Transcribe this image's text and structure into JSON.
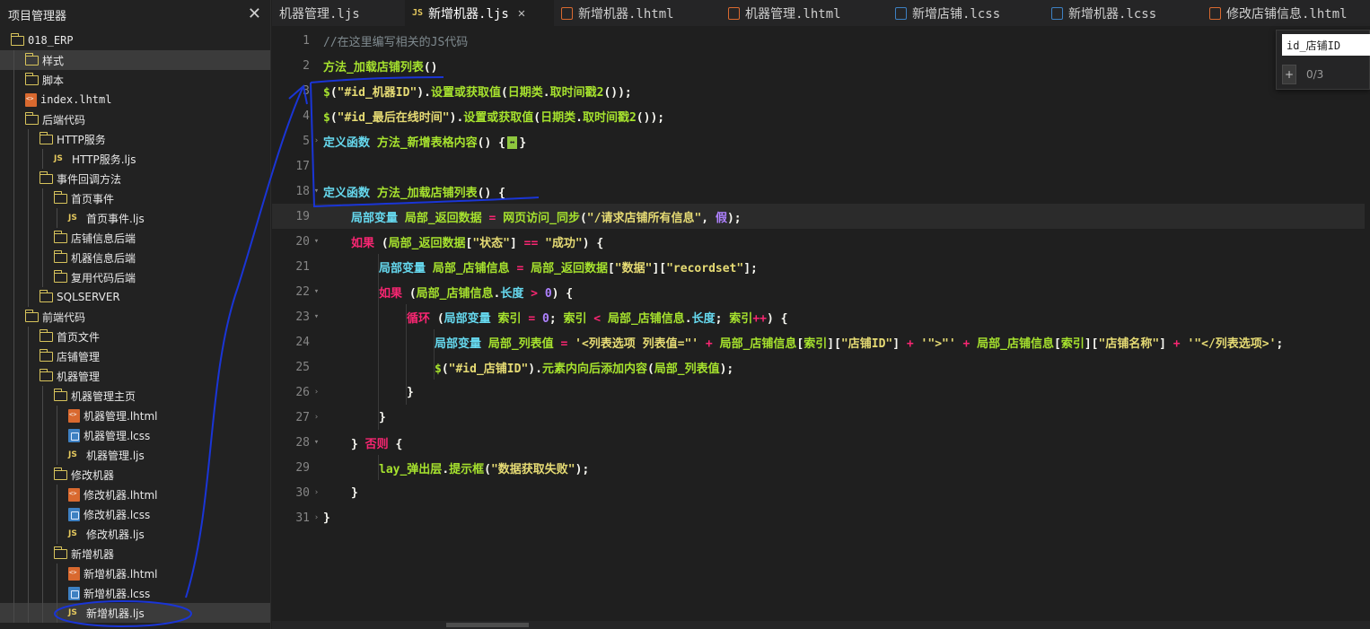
{
  "sidebar": {
    "title": "项目管理器",
    "close": "✕",
    "tree": [
      {
        "label": "018_ERP",
        "kind": "folder",
        "depth": 0,
        "mono": true
      },
      {
        "label": "样式",
        "kind": "folder",
        "depth": 1,
        "selected": true
      },
      {
        "label": "脚本",
        "kind": "folder",
        "depth": 1
      },
      {
        "label": "index.lhtml",
        "kind": "html",
        "depth": 1,
        "mono": true
      },
      {
        "label": "后端代码",
        "kind": "folder",
        "depth": 1
      },
      {
        "label": "HTTP服务",
        "kind": "folder",
        "depth": 2
      },
      {
        "label": "HTTP服务.ljs",
        "kind": "js",
        "depth": 3
      },
      {
        "label": "事件回调方法",
        "kind": "folder",
        "depth": 2
      },
      {
        "label": "首页事件",
        "kind": "folder",
        "depth": 3
      },
      {
        "label": "首页事件.ljs",
        "kind": "js",
        "depth": 4
      },
      {
        "label": "店铺信息后端",
        "kind": "folder",
        "depth": 3
      },
      {
        "label": "机器信息后端",
        "kind": "folder",
        "depth": 3
      },
      {
        "label": "复用代码后端",
        "kind": "folder",
        "depth": 3
      },
      {
        "label": "SQLSERVER",
        "kind": "folder",
        "depth": 2
      },
      {
        "label": "前端代码",
        "kind": "folder",
        "depth": 1
      },
      {
        "label": "首页文件",
        "kind": "folder",
        "depth": 2
      },
      {
        "label": "店铺管理",
        "kind": "folder",
        "depth": 2
      },
      {
        "label": "机器管理",
        "kind": "folder",
        "depth": 2
      },
      {
        "label": "机器管理主页",
        "kind": "folder",
        "depth": 3
      },
      {
        "label": "机器管理.lhtml",
        "kind": "html",
        "depth": 4
      },
      {
        "label": "机器管理.lcss",
        "kind": "css",
        "depth": 4
      },
      {
        "label": "机器管理.ljs",
        "kind": "js",
        "depth": 4
      },
      {
        "label": "修改机器",
        "kind": "folder",
        "depth": 3
      },
      {
        "label": "修改机器.lhtml",
        "kind": "html",
        "depth": 4
      },
      {
        "label": "修改机器.lcss",
        "kind": "css",
        "depth": 4
      },
      {
        "label": "修改机器.ljs",
        "kind": "js",
        "depth": 4
      },
      {
        "label": "新增机器",
        "kind": "folder",
        "depth": 3
      },
      {
        "label": "新增机器.lhtml",
        "kind": "html",
        "depth": 4
      },
      {
        "label": "新增机器.lcss",
        "kind": "css",
        "depth": 4
      },
      {
        "label": "新增机器.ljs",
        "kind": "js",
        "depth": 4,
        "selected": true
      }
    ]
  },
  "tabs": [
    {
      "label": "机器管理.ljs",
      "icon": "none",
      "active": false
    },
    {
      "label": "新增机器.ljs",
      "icon": "js",
      "active": true,
      "close": "✕"
    },
    {
      "label": "新增机器.lhtml",
      "icon": "html",
      "active": false
    },
    {
      "label": "机器管理.lhtml",
      "icon": "html",
      "active": false
    },
    {
      "label": "新增店铺.lcss",
      "icon": "css",
      "active": false
    },
    {
      "label": "新增机器.lcss",
      "icon": "css",
      "active": false
    },
    {
      "label": "修改店铺信息.lhtml",
      "icon": "html",
      "active": false
    }
  ],
  "find": {
    "value": "id_店铺ID",
    "toggle": "+",
    "count": "0/3"
  },
  "editor": {
    "lines": [
      {
        "n": "1",
        "indent": 0,
        "tokens": [
          [
            "cmt",
            "//在这里编写相关的JS代码"
          ]
        ]
      },
      {
        "n": "2",
        "indent": 0,
        "tokens": [
          [
            "fn",
            "方法_加载店铺列表"
          ],
          [
            "pl",
            "()"
          ]
        ]
      },
      {
        "n": "3",
        "indent": 0,
        "tokens": [
          [
            "fn",
            "$"
          ],
          [
            "pl",
            "("
          ],
          [
            "str",
            "\"#id_机器ID\""
          ],
          [
            "pl",
            ")."
          ],
          [
            "fn",
            "设置或获取值"
          ],
          [
            "pl",
            "("
          ],
          [
            "fn",
            "日期类"
          ],
          [
            "pl",
            "."
          ],
          [
            "fn",
            "取时间戳2"
          ],
          [
            "pl",
            "());"
          ]
        ]
      },
      {
        "n": "4",
        "indent": 0,
        "tokens": [
          [
            "fn",
            "$"
          ],
          [
            "pl",
            "("
          ],
          [
            "str",
            "\"#id_最后在线时间\""
          ],
          [
            "pl",
            ")."
          ],
          [
            "fn",
            "设置或获取值"
          ],
          [
            "pl",
            "("
          ],
          [
            "fn",
            "日期类"
          ],
          [
            "pl",
            "."
          ],
          [
            "fn",
            "取时间戳2"
          ],
          [
            "pl",
            "());"
          ]
        ]
      },
      {
        "n": "5",
        "indent": 0,
        "fold": "›",
        "tokens": [
          [
            "kw",
            "定义函数 "
          ],
          [
            "fn",
            "方法_新增表格内容"
          ],
          [
            "pl",
            "() {"
          ],
          [
            "box",
            "↔"
          ],
          [
            "pl",
            "}"
          ]
        ]
      },
      {
        "n": "17",
        "indent": 0,
        "tokens": []
      },
      {
        "n": "18",
        "indent": 0,
        "fold": "▾",
        "tokens": [
          [
            "kw",
            "定义函数 "
          ],
          [
            "fn",
            "方法_加载店铺列表"
          ],
          [
            "pl",
            "() {"
          ]
        ]
      },
      {
        "n": "19",
        "indent": 1,
        "current": true,
        "tokens": [
          [
            "kw",
            "局部变量 "
          ],
          [
            "fn",
            "局部_返回数据"
          ],
          [
            "op",
            " = "
          ],
          [
            "fn",
            "网页访问_同步"
          ],
          [
            "pl",
            "("
          ],
          [
            "str",
            "\"/请求店铺所有信息\""
          ],
          [
            "pl",
            ", "
          ],
          [
            "num",
            "假"
          ],
          [
            "pl",
            ");"
          ]
        ]
      },
      {
        "n": "20",
        "indent": 1,
        "fold": "▾",
        "tokens": [
          [
            "op",
            "如果 "
          ],
          [
            "pl",
            "("
          ],
          [
            "fn",
            "局部_返回数据"
          ],
          [
            "pl",
            "["
          ],
          [
            "str",
            "\"状态\""
          ],
          [
            "pl",
            "] "
          ],
          [
            "op",
            "=="
          ],
          [
            "pl",
            " "
          ],
          [
            "str",
            "\"成功\""
          ],
          [
            "pl",
            ") {"
          ]
        ]
      },
      {
        "n": "21",
        "indent": 2,
        "tokens": [
          [
            "kw",
            "局部变量 "
          ],
          [
            "fn",
            "局部_店铺信息"
          ],
          [
            "op",
            " = "
          ],
          [
            "fn",
            "局部_返回数据"
          ],
          [
            "pl",
            "["
          ],
          [
            "str",
            "\"数据\""
          ],
          [
            "pl",
            "]["
          ],
          [
            "str",
            "\"recordset\""
          ],
          [
            "pl",
            "];"
          ]
        ]
      },
      {
        "n": "22",
        "indent": 2,
        "fold": "▾",
        "tokens": [
          [
            "op",
            "如果 "
          ],
          [
            "pl",
            "("
          ],
          [
            "fn",
            "局部_店铺信息"
          ],
          [
            "pl",
            "."
          ],
          [
            "kw",
            "长度"
          ],
          [
            "op",
            " > "
          ],
          [
            "num",
            "0"
          ],
          [
            "pl",
            ") {"
          ]
        ]
      },
      {
        "n": "23",
        "indent": 3,
        "fold": "▾",
        "tokens": [
          [
            "op",
            "循环 "
          ],
          [
            "pl",
            "("
          ],
          [
            "kw",
            "局部变量 "
          ],
          [
            "fn",
            "索引"
          ],
          [
            "op",
            " = "
          ],
          [
            "num",
            "0"
          ],
          [
            "pl",
            "; "
          ],
          [
            "fn",
            "索引"
          ],
          [
            "op",
            " < "
          ],
          [
            "fn",
            "局部_店铺信息"
          ],
          [
            "pl",
            "."
          ],
          [
            "kw",
            "长度"
          ],
          [
            "pl",
            "; "
          ],
          [
            "fn",
            "索引"
          ],
          [
            "op",
            "++"
          ],
          [
            "pl",
            ") {"
          ]
        ]
      },
      {
        "n": "24",
        "indent": 4,
        "tokens": [
          [
            "kw",
            "局部变量 "
          ],
          [
            "fn",
            "局部_列表值"
          ],
          [
            "op",
            " = "
          ],
          [
            "str",
            "'<列表选项 列表值=\"'"
          ],
          [
            "op",
            " + "
          ],
          [
            "fn",
            "局部_店铺信息"
          ],
          [
            "pl",
            "["
          ],
          [
            "fn",
            "索引"
          ],
          [
            "pl",
            "]["
          ],
          [
            "str",
            "\"店铺ID\""
          ],
          [
            "pl",
            "]"
          ],
          [
            "op",
            " + "
          ],
          [
            "str",
            "'\">\"'"
          ],
          [
            "op",
            " + "
          ],
          [
            "fn",
            "局部_店铺信息"
          ],
          [
            "pl",
            "["
          ],
          [
            "fn",
            "索引"
          ],
          [
            "pl",
            "]["
          ],
          [
            "str",
            "\"店铺名称\""
          ],
          [
            "pl",
            "]"
          ],
          [
            "op",
            " + "
          ],
          [
            "str",
            "'\"</列表选项>'"
          ],
          [
            "pl",
            ";"
          ]
        ]
      },
      {
        "n": "25",
        "indent": 4,
        "tokens": [
          [
            "fn",
            "$"
          ],
          [
            "pl",
            "("
          ],
          [
            "str",
            "\"#id_店铺ID\""
          ],
          [
            "pl",
            ")."
          ],
          [
            "fn",
            "元素内向后添加内容"
          ],
          [
            "pl",
            "("
          ],
          [
            "fn",
            "局部_列表值"
          ],
          [
            "pl",
            ");"
          ]
        ]
      },
      {
        "n": "26",
        "indent": 3,
        "fold": "›",
        "tokens": [
          [
            "pl",
            "}"
          ]
        ]
      },
      {
        "n": "27",
        "indent": 2,
        "fold": "›",
        "tokens": [
          [
            "pl",
            "}"
          ]
        ]
      },
      {
        "n": "28",
        "indent": 1,
        "fold": "▾",
        "tokens": [
          [
            "pl",
            "} "
          ],
          [
            "op",
            "否则"
          ],
          [
            "pl",
            " {"
          ]
        ]
      },
      {
        "n": "29",
        "indent": 2,
        "tokens": [
          [
            "fn",
            "lay_弹出层"
          ],
          [
            "pl",
            "."
          ],
          [
            "fn",
            "提示框"
          ],
          [
            "pl",
            "("
          ],
          [
            "str",
            "\"数据获取失败\""
          ],
          [
            "pl",
            ");"
          ]
        ]
      },
      {
        "n": "30",
        "indent": 1,
        "fold": "›",
        "tokens": [
          [
            "pl",
            "}"
          ]
        ]
      },
      {
        "n": "31",
        "indent": 0,
        "fold": "›",
        "tokens": [
          [
            "pl",
            "}"
          ]
        ]
      }
    ]
  }
}
